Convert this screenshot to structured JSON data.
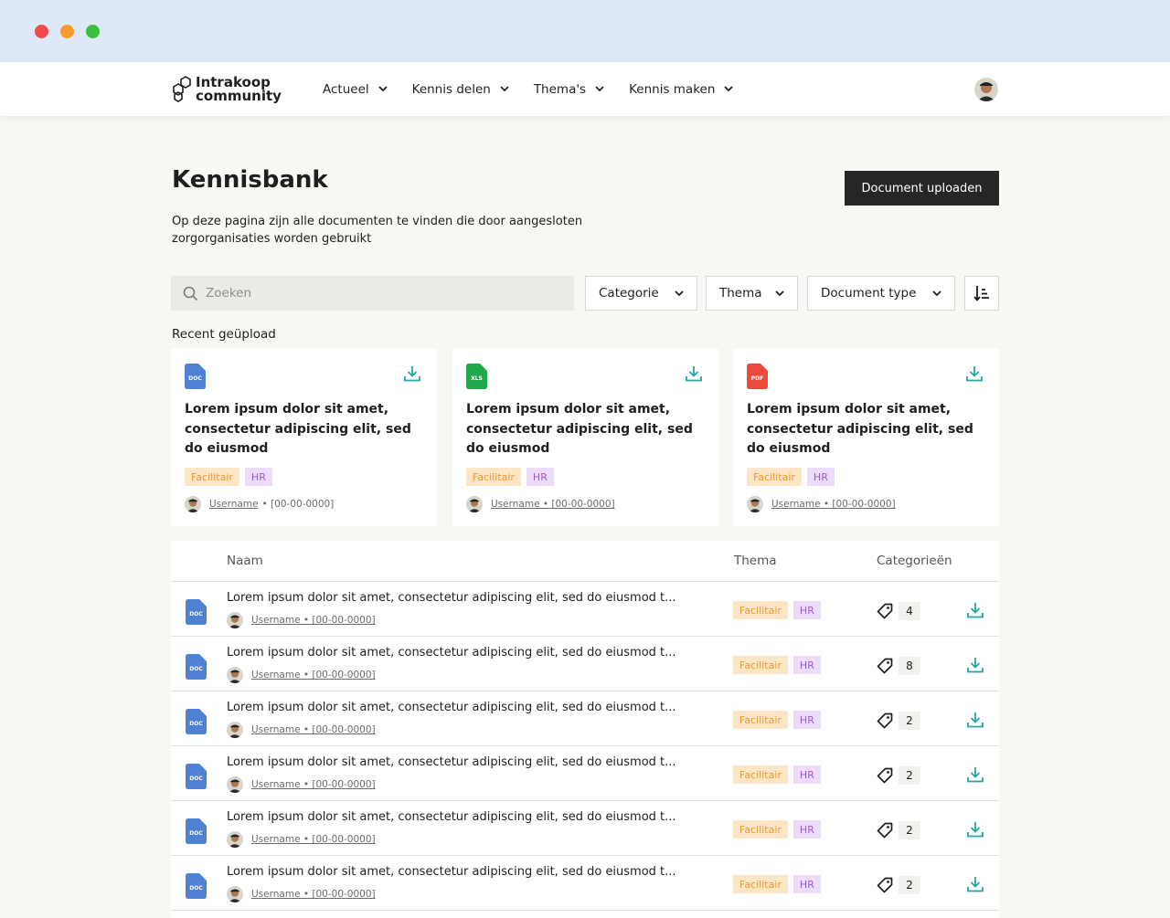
{
  "colors": {
    "accent_teal": "#23a6a6",
    "dark_button": "#262626",
    "tag_facilitair_bg": "#fde6c6",
    "tag_facilitair_text": "#e89a2f",
    "tag_hr_bg": "#ecdcfa",
    "tag_hr_text": "#9b59d0",
    "doc_blue": "#4f82d3",
    "xls_green": "#21a849",
    "pdf_red": "#ec4a3c"
  },
  "nav": {
    "logo_line1": "Intrakoop",
    "logo_line2": "community",
    "items": [
      {
        "label": "Actueel"
      },
      {
        "label": "Kennis delen"
      },
      {
        "label": "Thema's"
      },
      {
        "label": "Kennis maken"
      }
    ]
  },
  "header": {
    "title": "Kennisbank",
    "description": "Op deze pagina zijn alle documenten te vinden die door aangesloten zorgorganisaties worden gebruikt",
    "upload_label": "Document uploaden"
  },
  "filters": {
    "search_placeholder": "Zoeken",
    "categorie": "Categorie",
    "thema": "Thema",
    "document_type": "Document type"
  },
  "recent": {
    "label": "Recent geüpload",
    "cards": [
      {
        "icon": "doc-file-icon",
        "type_label": "DOC",
        "title": "Lorem ipsum dolor sit amet, consectetur adipiscing elit, sed do eiusmod",
        "tags": [
          "Facilitair",
          "HR"
        ],
        "username": "Username",
        "date": "• [00-00-0000]"
      },
      {
        "icon": "xls-file-icon",
        "type_label": "XLS",
        "title": "Lorem ipsum dolor sit amet, consectetur adipiscing elit, sed do eiusmod",
        "tags": [
          "Facilitair",
          "HR"
        ],
        "username": "Username • [00-00-0000]",
        "date": ""
      },
      {
        "icon": "pdf-file-icon",
        "type_label": "PDF",
        "title": "Lorem ipsum dolor sit amet, consectetur adipiscing elit, sed do eiusmod",
        "tags": [
          "Facilitair",
          "HR"
        ],
        "username": "Username • [00-00-0000]",
        "date": ""
      }
    ]
  },
  "table": {
    "headers": {
      "naam": "Naam",
      "thema": "Thema",
      "categorieen": "Categorieën"
    },
    "rows": [
      {
        "type_label": "DOC",
        "title": "Lorem ipsum dolor sit amet, consectetur adipiscing elit, sed do eiusmod t...",
        "meta": "Username • [00-00-0000]",
        "tags": [
          "Facilitair",
          "HR"
        ],
        "count": "4"
      },
      {
        "type_label": "DOC",
        "title": "Lorem ipsum dolor sit amet, consectetur adipiscing elit, sed do eiusmod t...",
        "meta": "Username • [00-00-0000]",
        "tags": [
          "Facilitair",
          "HR"
        ],
        "count": "8"
      },
      {
        "type_label": "DOC",
        "title": "Lorem ipsum dolor sit amet, consectetur adipiscing elit, sed do eiusmod t...",
        "meta": "Username • [00-00-0000]",
        "tags": [
          "Facilitair",
          "HR"
        ],
        "count": "2"
      },
      {
        "type_label": "DOC",
        "title": "Lorem ipsum dolor sit amet, consectetur adipiscing elit, sed do eiusmod t...",
        "meta": "Username • [00-00-0000]",
        "tags": [
          "Facilitair",
          "HR"
        ],
        "count": "2"
      },
      {
        "type_label": "DOC",
        "title": "Lorem ipsum dolor sit amet, consectetur adipiscing elit, sed do eiusmod t...",
        "meta": "Username • [00-00-0000]",
        "tags": [
          "Facilitair",
          "HR"
        ],
        "count": "2"
      },
      {
        "type_label": "DOC",
        "title": "Lorem ipsum dolor sit amet, consectetur adipiscing elit, sed do eiusmod t...",
        "meta": "Username • [00-00-0000]",
        "tags": [
          "Facilitair",
          "HR"
        ],
        "count": "2"
      }
    ]
  }
}
